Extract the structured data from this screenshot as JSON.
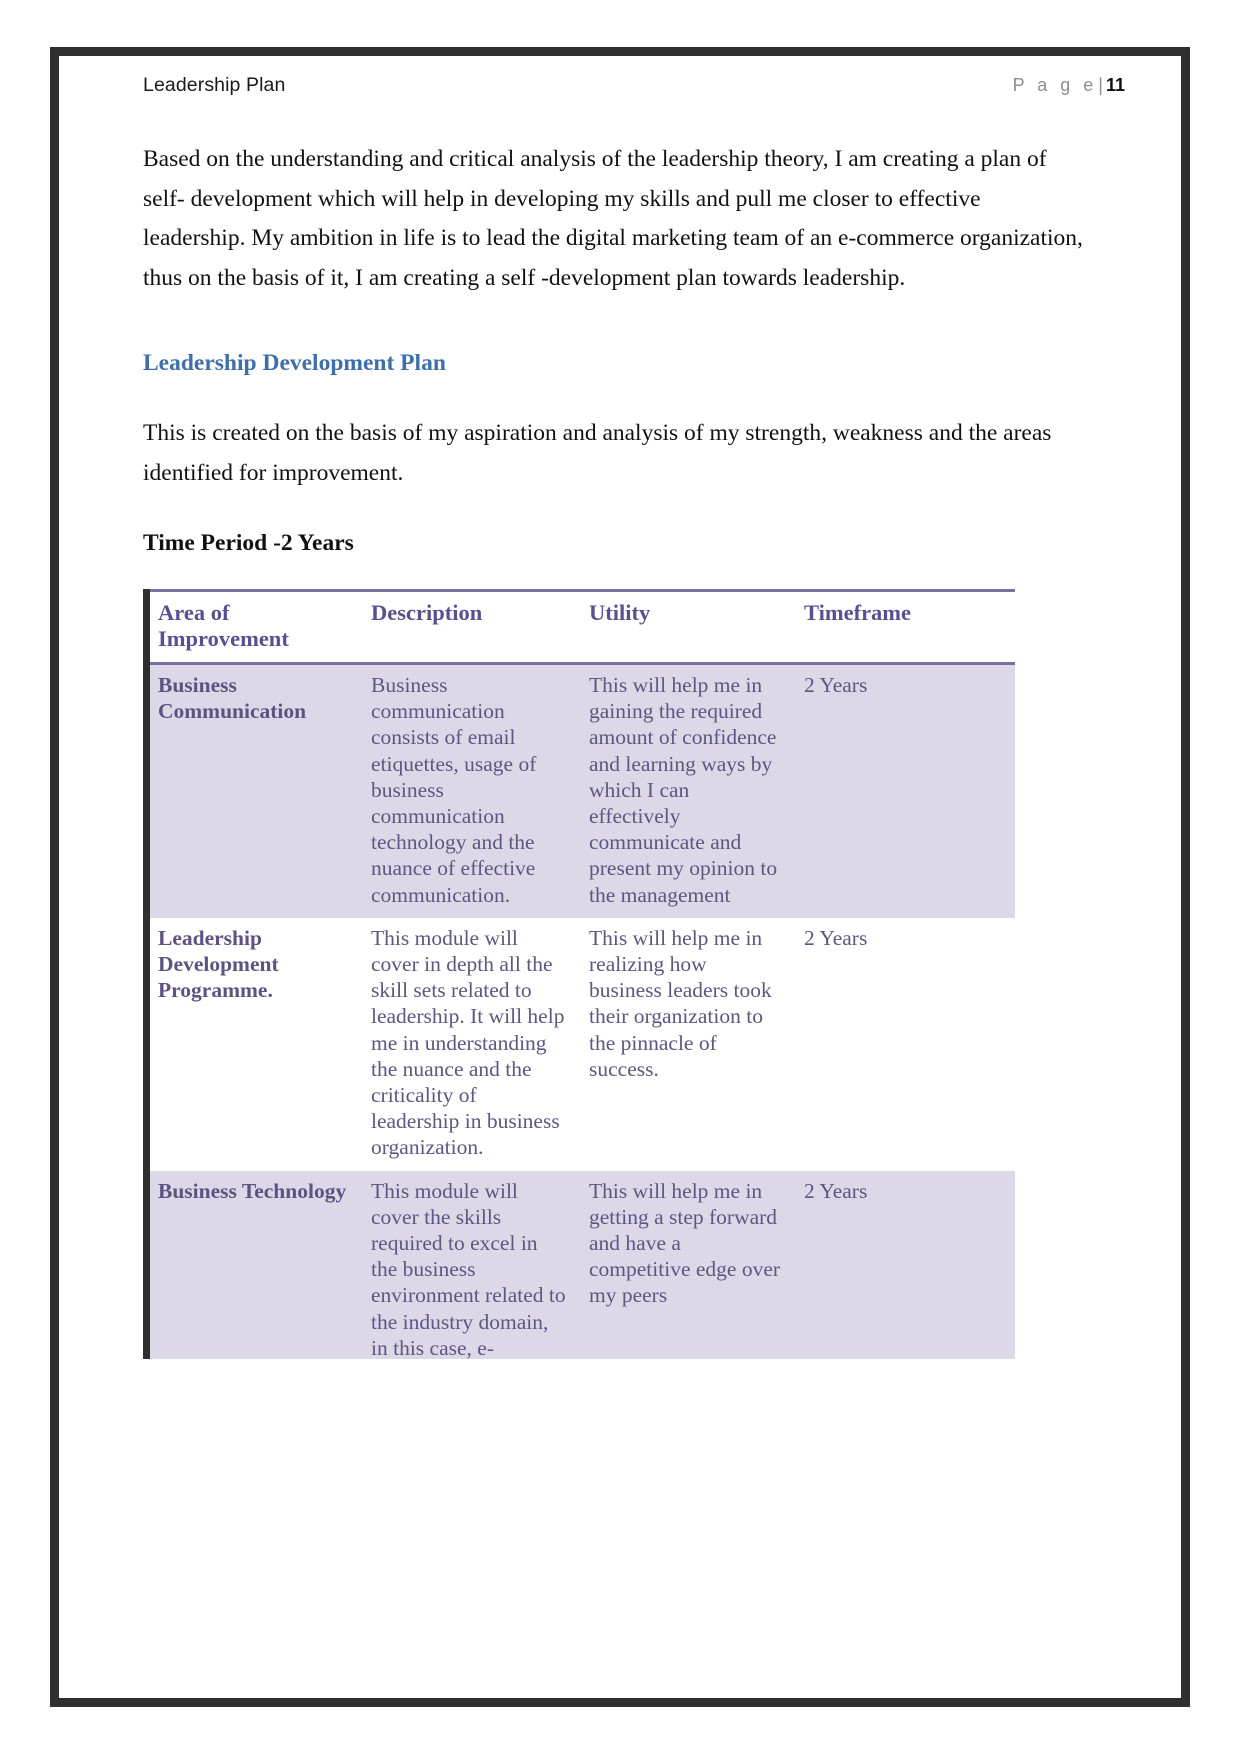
{
  "header": {
    "doc_title": "Leadership Plan",
    "page_word": "P a g e",
    "page_separator": "|",
    "page_number": "11"
  },
  "body": {
    "paragraph_1": "Based on the understanding and critical analysis of the leadership theory, I am creating a plan of self- development which will help in developing my skills and pull me closer to effective leadership. My ambition in life is to lead the digital marketing team of an e-commerce organization, thus on the basis of it, I am creating a self -development plan towards leadership.",
    "section_heading": "Leadership Development Plan",
    "paragraph_2": "This is created on the basis of my aspiration and analysis of my strength, weakness and the areas identified for improvement.",
    "time_period": "Time Period -2 Years"
  },
  "table": {
    "columns": [
      "Area of Improvement",
      "Description",
      "Utility",
      "Timeframe"
    ],
    "rows": [
      {
        "area": "Business Communication",
        "description": "Business communication consists of email etiquettes, usage of business communication technology and the nuance of effective communication.",
        "utility": "This will help me in gaining the required amount of confidence and learning ways by which I can effectively communicate and present my opinion to the management",
        "timeframe": "2 Years"
      },
      {
        "area": "Leadership Development Programme.",
        "description": "This module will cover in depth all the skill sets related to leadership. It will help me in understanding the nuance and the criticality of leadership in business organization.",
        "utility": "This will help me in realizing how business leaders took their organization to the pinnacle of success.",
        "timeframe": "2 Years"
      },
      {
        "area": "Business Technology",
        "description": "This module will cover the skills required to excel in the business environment related to the industry domain, in this case, e-",
        "utility": "This will help me in getting a step forward and have a competitive edge over my peers",
        "timeframe": "2 Years"
      }
    ]
  },
  "colors": {
    "heading_blue": "#3f6fa8",
    "table_header_purple": "#585091",
    "table_row_shade": "#ddd8e8",
    "frame_dark": "#2f2f2f"
  }
}
